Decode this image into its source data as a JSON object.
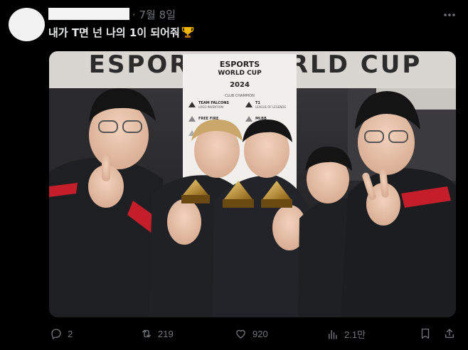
{
  "post": {
    "date": "· 7월 8일",
    "text": "내가 T면 넌 나의 1이 되어줘",
    "trophy_icon": "trophy-emoji"
  },
  "media": {
    "backdrop_text": "ESPORTS WORLD CUP",
    "board": {
      "logo_line1": "ESPORTS",
      "logo_line2": "WORLD CUP",
      "year": "2024",
      "subtitle": "CLUB CHAMPION",
      "rows": [
        {
          "name": "TEAM FALCONS",
          "sub": "LOGO INVENTION",
          "name2": "T1",
          "sub2": "LEAGUE OF LEGENDS"
        },
        {
          "name": "FREE FIRE",
          "sub": "",
          "name2": "MLBB",
          "sub2": ""
        },
        {
          "name": "",
          "sub": "",
          "name2": "",
          "sub2": ""
        }
      ]
    }
  },
  "actions": {
    "replies": "2",
    "reposts": "219",
    "likes": "920",
    "views": "2.1만"
  },
  "colors": {
    "background": "#000000",
    "text": "#e7e9ea",
    "muted": "#71767b"
  }
}
